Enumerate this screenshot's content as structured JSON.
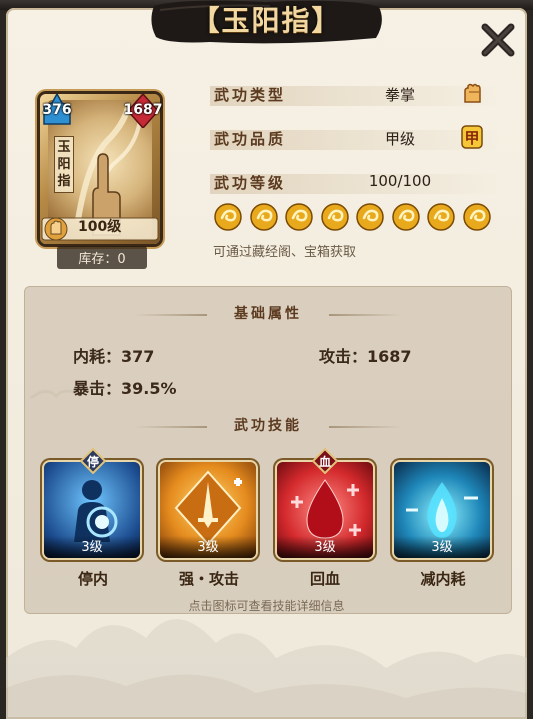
{
  "title": "【玉阳指】",
  "card": {
    "name": "玉阳指",
    "left_gem": "376",
    "right_gem": "1687",
    "level": "100级",
    "stock": "库存：0"
  },
  "info": {
    "type_label": "武功类型",
    "type_value": "拳掌",
    "grade_label": "武功品质",
    "grade_value": "甲级",
    "grade_icon_text": "甲",
    "level_label": "武功等级",
    "level_value": "100/100",
    "hint": "可通过藏经阁、宝箱获取"
  },
  "attributes": {
    "title": "基础属性",
    "stats": [
      {
        "label": "内耗：",
        "value": "377"
      },
      {
        "label": "攻击：",
        "value": "1687"
      },
      {
        "label": "暴击：",
        "value": "39.5%"
      }
    ]
  },
  "skills": {
    "title": "武功技能",
    "items": [
      {
        "name": "停内",
        "level": "3级",
        "tag": "停",
        "icon": "stop-internal-icon"
      },
      {
        "name": "强・攻击",
        "level": "3级",
        "tag": "",
        "icon": "attack-up-icon"
      },
      {
        "name": "回血",
        "level": "3级",
        "tag": "血",
        "icon": "heal-blood-icon"
      },
      {
        "name": "减内耗",
        "level": "3级",
        "tag": "",
        "icon": "reduce-cost-icon"
      }
    ],
    "hint": "点击图标可查看技能详细信息"
  },
  "colors": {
    "panel": "#f2ecdf",
    "title_text": "#f3d7a1",
    "label_text": "#5b3a1f"
  }
}
